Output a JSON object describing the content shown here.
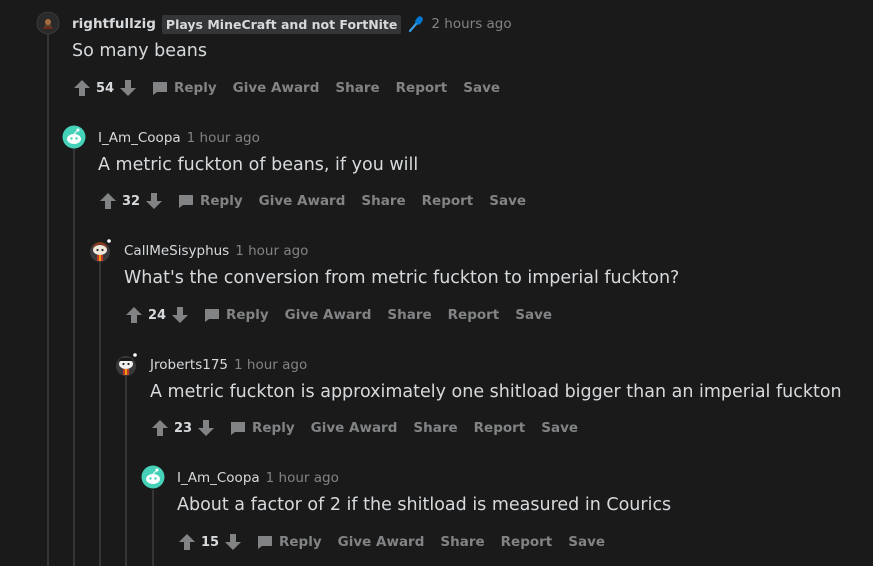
{
  "comments": [
    {
      "username": "rightfullzig",
      "flair": "Plays MineCraft and not FortNite",
      "flair_icon": "microphone-icon",
      "timestamp": "2 hours ago",
      "body": "So many beans",
      "score": "54",
      "avatar": "dark-character-avatar"
    },
    {
      "username": "I_Am_Coopa",
      "timestamp": "1 hour ago",
      "body": "A metric fuckton of beans, if you will",
      "score": "32",
      "avatar": "snoo-teal-avatar"
    },
    {
      "username": "CallMeSisyphus",
      "timestamp": "1 hour ago",
      "body": "What's the conversion from metric fuckton to imperial fuckton?",
      "score": "24",
      "avatar": "snoo-avatar-1"
    },
    {
      "username": "Jroberts175",
      "timestamp": "1 hour ago",
      "body": "A metric fuckton is approximately one shitload bigger than an imperial fuckton",
      "score": "23",
      "avatar": "snoo-avatar-2"
    },
    {
      "username": "I_Am_Coopa",
      "timestamp": "1 hour ago",
      "body": "About a factor of 2 if the shitload is measured in Courics",
      "score": "15",
      "avatar": "snoo-teal-avatar"
    }
  ],
  "actions": {
    "reply": "Reply",
    "give_award": "Give Award",
    "share": "Share",
    "report": "Report",
    "save": "Save"
  },
  "colors": {
    "background": "#1a1a1b",
    "text": "#d7dadc",
    "muted": "#818384",
    "threadline": "#343536",
    "flair_bg": "#343536",
    "mic_blue": "#0079d3",
    "snoo_teal": "#46d1b9"
  }
}
